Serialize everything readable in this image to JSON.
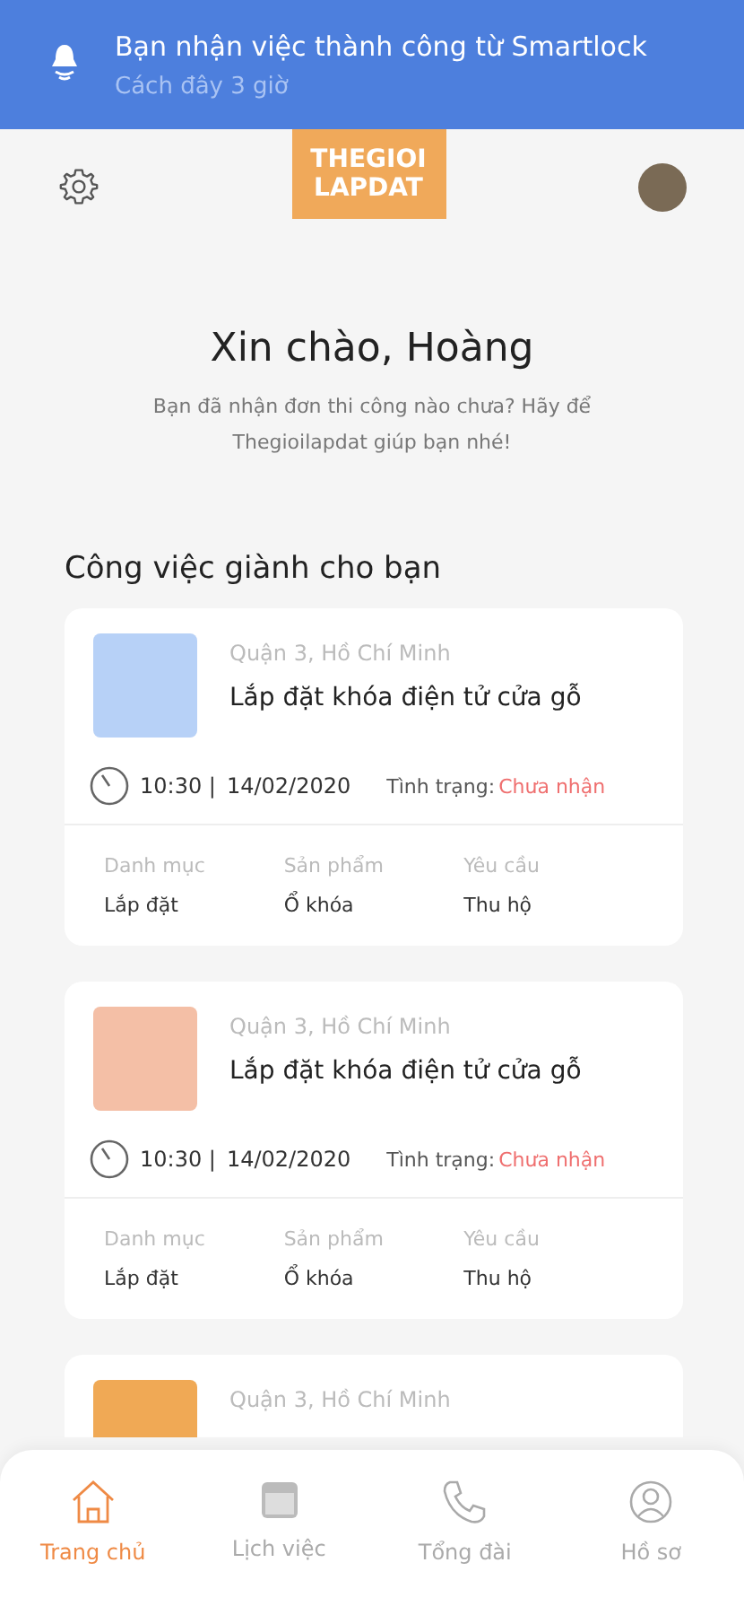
{
  "notification": {
    "title": "Bạn nhận việc thành công từ Smartlock",
    "time": "Cách đây 3 giờ"
  },
  "header": {
    "logo": [
      "THEGIOI",
      "LAPDAT"
    ]
  },
  "greeting": {
    "title": "Xin chào, Hoàng",
    "subtitle": "Bạn đã nhận đơn thi công nào chưa? Hãy để Thegioilapdat giúp bạn nhé!"
  },
  "section_title": "Công việc giành cho bạn",
  "jobs": [
    {
      "color": "#b7d1f7",
      "location": "Quận 3, Hồ Chí Minh",
      "title": "Lắp đặt khóa điện tử cửa gỗ",
      "time": "10:30 |",
      "date": "14/02/2020",
      "status_label": "Tình trạng:",
      "status": "Chưa nhận",
      "details": [
        {
          "label": "Danh mục",
          "value": "Lắp đặt"
        },
        {
          "label": "Sản phẩm",
          "value": "Ổ khóa"
        },
        {
          "label": "Yêu cầu",
          "value": "Thu hộ"
        }
      ]
    },
    {
      "color": "#f4bfa6",
      "location": "Quận 3, Hồ Chí Minh",
      "title": "Lắp đặt khóa điện tử cửa gỗ",
      "time": "10:30 |",
      "date": "14/02/2020",
      "status_label": "Tình trạng:",
      "status": "Chưa nhận",
      "details": [
        {
          "label": "Danh mục",
          "value": "Lắp đặt"
        },
        {
          "label": "Sản phẩm",
          "value": "Ổ khóa"
        },
        {
          "label": "Yêu cầu",
          "value": "Thu hộ"
        }
      ]
    },
    {
      "color": "#f0a955",
      "location": "Quận 3, Hồ Chí Minh"
    }
  ],
  "nav": [
    {
      "kind": "home",
      "label": "Trang chủ",
      "selected": true
    },
    {
      "kind": "calendar",
      "label": "Lịch việc",
      "selected": false
    },
    {
      "kind": "phone",
      "label": "Tổng đài",
      "selected": false
    },
    {
      "kind": "profile",
      "label": "Hồ sơ",
      "selected": false
    }
  ]
}
